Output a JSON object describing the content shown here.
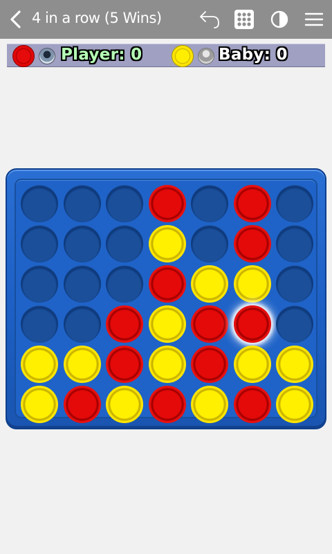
{
  "app_bar": {
    "title": "4 in a row (5 Wins)",
    "back_icon": "chevron-left-icon",
    "undo_icon": "undo-icon",
    "grid_icon": "grid-icon",
    "contrast_icon": "contrast-icon",
    "menu_icon": "menu-icon"
  },
  "score": {
    "player": {
      "label": "Player:",
      "value": "0",
      "chip_color": "red"
    },
    "baby": {
      "label": "Baby:",
      "value": "0",
      "chip_color": "yellow"
    }
  },
  "board": {
    "rows": 6,
    "cols": 7,
    "cells": [
      [
        "empty",
        "empty",
        "empty",
        "red",
        "empty",
        "red",
        "empty"
      ],
      [
        "empty",
        "empty",
        "empty",
        "yellow",
        "empty",
        "red",
        "empty"
      ],
      [
        "empty",
        "empty",
        "empty",
        "red",
        "yellow",
        "yellow",
        "empty"
      ],
      [
        "empty",
        "empty",
        "red",
        "yellow",
        "red",
        "red",
        "empty"
      ],
      [
        "yellow",
        "yellow",
        "red",
        "yellow",
        "red",
        "yellow",
        "yellow"
      ],
      [
        "yellow",
        "red",
        "yellow",
        "red",
        "yellow",
        "red",
        "yellow"
      ]
    ],
    "last_move": {
      "row": 3,
      "col": 5
    }
  },
  "colors": {
    "app_bar": "#8e8e8e",
    "board": "#1d5fc4",
    "red_chip": "#e40a0a",
    "yellow_chip": "#fff000"
  }
}
